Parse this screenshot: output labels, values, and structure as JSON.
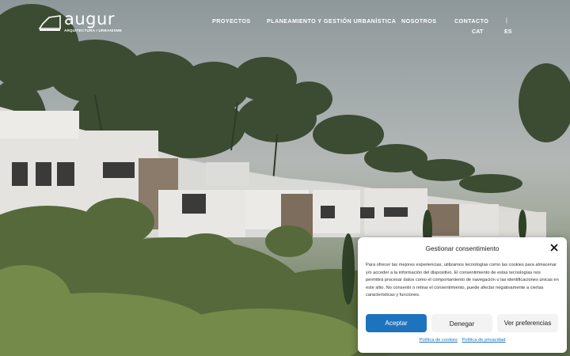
{
  "logo": {
    "word": "augur",
    "subtitle": "ARQUITECTURA I URBANISME"
  },
  "nav": {
    "items": [
      "PROYECTOS",
      "PLANEAMIENTO Y GESTIÓN URBANÍSTICA",
      "NOSOTROS",
      "CONTACTO"
    ],
    "lang_cat": "CAT",
    "lang_separator": "|",
    "lang_es": "ES"
  },
  "consent": {
    "title": "Gestionar consentimiento",
    "body": "Para ofrecer las mejores experiencias, utilizamos tecnologías como las cookies para almacenar y/o acceder a la información del dispositivo. El consentimiento de estas tecnologías nos permitirá procesar datos como el comportamiento de navegación o las identificaciones únicas en este sitio. No consentir o retirar el consentimiento, puede afectar negativamente a ciertas características y funciones.",
    "accept_label": "Aceptar",
    "deny_label": "Denegar",
    "prefs_label": "Ver preferencias",
    "cookie_policy": "Política de cookies",
    "privacy_policy": "Política de privacidad"
  },
  "colors": {
    "accent": "#1e73be",
    "header_text": "#ffffff"
  }
}
